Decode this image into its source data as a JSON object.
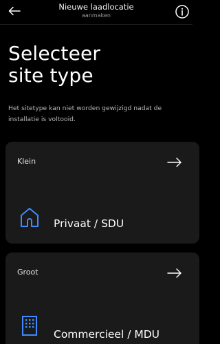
{
  "header": {
    "title": "Nieuwe laadlocatie",
    "subtitle": "aanmaken",
    "back_icon": "arrow-left-icon",
    "info_icon": "info-circle-icon"
  },
  "main": {
    "title_line1": "Selecteer",
    "title_line2": "site type",
    "description": "Het sitetype kan niet worden gewijzigd nadat de installatie is voltooid."
  },
  "site_types": [
    {
      "size": "Klein",
      "name": "Privaat / SDU",
      "icon": "house-icon"
    },
    {
      "size": "Groot",
      "name": "Commercieel / MDU",
      "icon": "office-building-icon"
    }
  ],
  "colors": {
    "background": "#000000",
    "card": "#1a1a1a",
    "accent": "#3d8bff"
  }
}
